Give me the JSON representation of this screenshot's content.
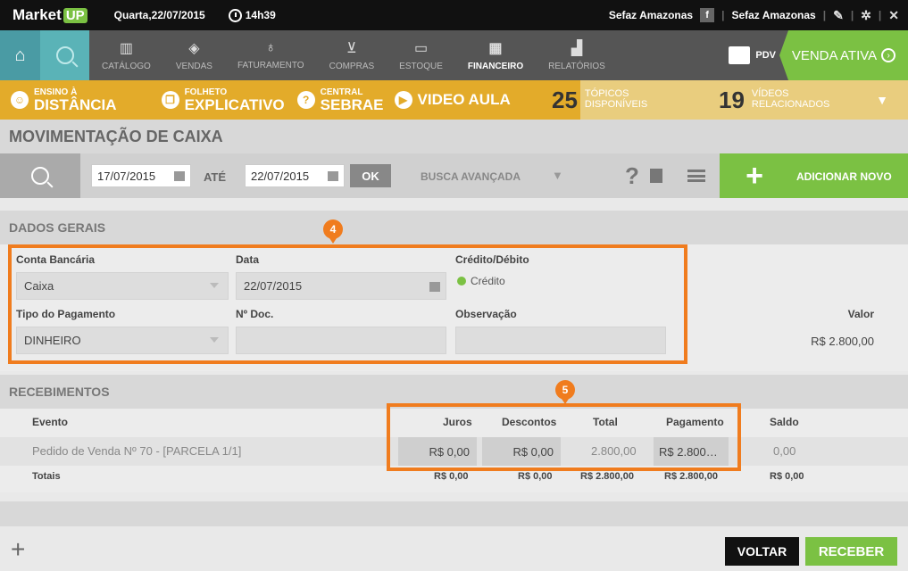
{
  "topbar": {
    "logo_main": "Market",
    "logo_up": "UP",
    "date": "Quarta,22/07/2015",
    "time": "14h39",
    "account1": "Sefaz Amazonas",
    "fb_label": "f",
    "account2": "Sefaz Amazonas"
  },
  "nav": {
    "items": [
      {
        "label": "CATÁLOGO",
        "icon": "barcode-icon",
        "glyph": "▥"
      },
      {
        "label": "VENDAS",
        "icon": "tag-icon",
        "glyph": "◈"
      },
      {
        "label": "FATURAMENTO",
        "icon": "money-bag-icon",
        "glyph": "♁"
      },
      {
        "label": "COMPRAS",
        "icon": "basket-icon",
        "glyph": "⊻"
      },
      {
        "label": "ESTOQUE",
        "icon": "box-icon",
        "glyph": "▭"
      },
      {
        "label": "FINANCEIRO",
        "icon": "calculator-icon",
        "glyph": "▦"
      },
      {
        "label": "RELATÓRIOS",
        "icon": "bar-chart-icon",
        "glyph": "▟"
      }
    ],
    "active": "FINANCEIRO",
    "pdv_label": "PDV",
    "venda_ativa": "VENDA ATIVA"
  },
  "promo": {
    "ead_small": "ENSINO À",
    "ead_big": "DISTÂNCIA",
    "folheto_small": "FOLHETO",
    "folheto_big": "EXPLICATIVO",
    "central_small": "CENTRAL",
    "central_big": "SEBRAE",
    "video_aula": "VIDEO AULA",
    "topicos_num": "25",
    "topicos_line1": "TÓPICOS",
    "topicos_line2": "DISPONÍVEIS",
    "videos_num": "19",
    "videos_line1": "VÍDEOS",
    "videos_line2": "RELACIONADOS"
  },
  "page": {
    "title": "MOVIMENTAÇÃO DE CAIXA"
  },
  "filter": {
    "date_from": "17/07/2015",
    "ate": "ATÉ",
    "date_to": "22/07/2015",
    "ok": "OK",
    "busca_avancada": "BUSCA AVANÇADA",
    "help": "?",
    "add_new": "ADICIONAR NOVO",
    "add_plus": "+"
  },
  "dados_gerais": {
    "title": "DADOS GERAIS",
    "conta_label": "Conta Bancária",
    "conta_value": "Caixa",
    "data_label": "Data",
    "data_value": "22/07/2015",
    "credito_label": "Crédito/Débito",
    "credito_value": "Crédito",
    "tipo_label": "Tipo do Pagamento",
    "tipo_value": "DINHEIRO",
    "ndoc_label": "Nº Doc.",
    "ndoc_value": "",
    "obs_label": "Observação",
    "obs_value": "",
    "valor_label": "Valor",
    "valor_value": "R$ 2.800,00"
  },
  "recebimentos": {
    "title": "RECEBIMENTOS",
    "headers": {
      "evento": "Evento",
      "juros": "Juros",
      "descontos": "Descontos",
      "total": "Total",
      "pagamento": "Pagamento",
      "saldo": "Saldo"
    },
    "row": {
      "evento": "Pedido de Venda Nº 70 - [PARCELA 1/1]",
      "juros": "R$ 0,00",
      "descontos": "R$ 0,00",
      "total": "2.800,00",
      "pagamento": "R$ 2.800…",
      "saldo": "0,00"
    },
    "totals": {
      "label": "Totais",
      "juros": "R$ 0,00",
      "descontos": "R$ 0,00",
      "total": "R$ 2.800,00",
      "pagamento": "R$ 2.800,00",
      "saldo": "R$ 0,00"
    }
  },
  "annotations": {
    "badge4": "4",
    "badge5": "5",
    "color": "#f07c1e"
  },
  "footer": {
    "add": "+",
    "voltar": "VOLTAR",
    "receber": "RECEBER"
  },
  "colors": {
    "green": "#7bc143",
    "yellow": "#e3ab2a",
    "teal": "#5ab3b7"
  }
}
